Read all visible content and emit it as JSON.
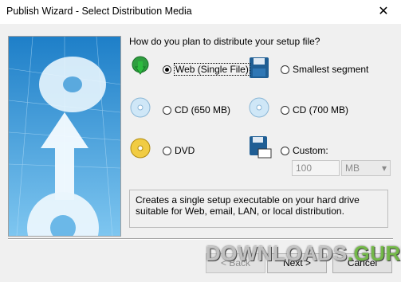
{
  "window": {
    "title": "Publish Wizard - Select Distribution Media",
    "close_glyph": "✕"
  },
  "prompt": "How do you plan to distribute your setup file?",
  "options": {
    "web": {
      "label": "Web (Single File)",
      "selected": true
    },
    "smallest": {
      "label": "Smallest segment",
      "selected": false
    },
    "cd650": {
      "label": "CD (650 MB)",
      "selected": false
    },
    "cd700": {
      "label": "CD (700 MB)",
      "selected": false
    },
    "dvd": {
      "label": "DVD",
      "selected": false
    },
    "custom": {
      "label": "Custom:",
      "selected": false
    }
  },
  "custom": {
    "size_value": "100",
    "unit": "MB"
  },
  "description": "Creates a single setup executable on your hard drive suitable for Web, email, LAN, or local distribution.",
  "buttons": {
    "back": "< Back",
    "next": "Next >",
    "cancel": "Cancel"
  },
  "watermark": {
    "text": "DOWNLOADS",
    "suffix": ".GURU"
  },
  "colors": {
    "accent": "#2f9bdc",
    "watermark_green": "#7bc849"
  }
}
